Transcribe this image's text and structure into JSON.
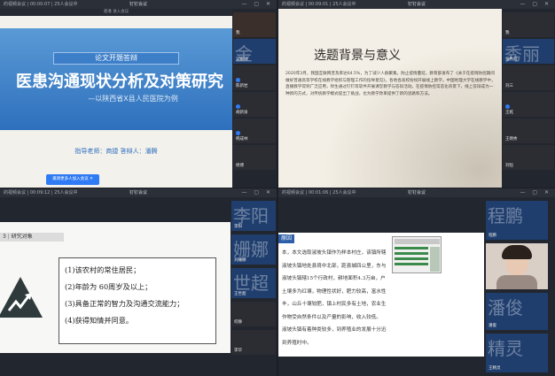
{
  "windows": {
    "tl": {
      "title": "钉钉会议",
      "meta": "的视频会议  |  00:00:07  |  25人会议中",
      "tabbar": "骆潘 进入会议"
    },
    "tr": {
      "title": "钉钉会议",
      "meta": "的视频会议  |  00:09:01  |  25人会议中"
    },
    "bl": {
      "title": "钉钉会议",
      "meta": "的视频会议  |  00:09:12  |  25人会议中"
    },
    "br": {
      "title": "钉钉会议",
      "meta": "的视频会议  |  00:01:06  |  25人会议中"
    },
    "controls": "— ▢ ✕"
  },
  "slide_tl": {
    "badge": "论文开题答辩",
    "title": "医患沟通现状分析及对策研究",
    "subtitle": "—以陕西省X县人民医院为例",
    "advisor": "指导老师：商捷  答辩人：潘腾",
    "share_button": "邀请更多人加入会议 ✕"
  },
  "slide_tr": {
    "title": "选题背景与意义",
    "paragraph": "2020年3月，我国互联网普及率达64.5%，为了减少人群聚集，防止疫情蔓延，教育部发布了《关于在疫情防控期间做好普通高等学校在线教学组织与管理工作的指导意见》，各地各高校纷纷开展线上教学。中国地理大学在线教学中，直播教学得到广泛应用，师生通过钉钉等软件开展课堂教学与答辩活动。在疫情防控常态化背景下，线上答辩成为一种新的方式，对传统教学模式提出了挑战，也为教学改革提供了新的思路和方法。"
  },
  "slide_bl": {
    "heading_num": "3",
    "heading": "研究对象",
    "items": [
      "(1)该农村的常住居民；",
      "(2)年龄为  60周岁及以上；",
      "(3)具备正常的智力及沟通交流能力；",
      "(4)获得知情并同意。"
    ]
  },
  "slide_br": {
    "tag": "原因",
    "lines": [
      "本，本文选取淑坡头镇作为样本村庄，该镇所辖",
      "淑坡头镇地处县境中北部，距县城四公里，东与",
      "淑坡头镇辖15个行政村，耕地面积4.3万亩，户",
      "土壤多为红壤，物理性状好，肥力较高，富水性",
      "丰，山丘十壤较肥，镇上村民多有土地，农业生",
      "作物受自然条件以及产量的影响，收入较低。",
      "淑坡头镇有着种类较多，到养殖业的发展十分迅",
      "到养殖时中。"
    ]
  },
  "side_tl": [
    {
      "big": "",
      "name": "我",
      "style": "dark"
    },
    {
      "big": "金",
      "name": "吴家祥",
      "style": "blue"
    },
    {
      "big": "",
      "name": "陈新岩",
      "style": "dark"
    },
    {
      "big": "",
      "name": "胡新泉",
      "style": "dark"
    },
    {
      "big": "",
      "name": "韩成林",
      "style": "dark"
    },
    {
      "big": "",
      "name": "杨博",
      "style": "dark"
    }
  ],
  "side_tr": [
    {
      "big": "",
      "name": "我",
      "style": "dark"
    },
    {
      "big": "秀丽",
      "name": "张秀丽",
      "style": "blue"
    },
    {
      "big": "",
      "name": "刘三",
      "style": "dark"
    },
    {
      "big": "",
      "name": "王乾",
      "style": "dark"
    },
    {
      "big": "",
      "name": "王明秀",
      "style": "dark"
    },
    {
      "big": "",
      "name": "刘恒",
      "style": "dark"
    }
  ],
  "side_bl": [
    {
      "big": "李阳",
      "name": "李阳",
      "style": "blue"
    },
    {
      "big": "姗娜",
      "name": "刘姗娜",
      "style": "blue"
    },
    {
      "big": "世超",
      "name": "王世超",
      "style": "blue"
    },
    {
      "big": "",
      "name": "何静",
      "style": "dark"
    },
    {
      "big": "",
      "name": "李华",
      "style": "dark"
    }
  ],
  "side_br": [
    {
      "big": "程鹏",
      "name": "程鹏",
      "style": "blue"
    },
    {
      "big": "",
      "name": "马丽莎",
      "style": "dark"
    },
    {
      "big": "潘俊",
      "name": "潘俊",
      "style": "blue"
    },
    {
      "big": "精灵",
      "name": "王精灵",
      "style": "blue"
    },
    {
      "big": "",
      "name": "严晓东",
      "style": "dark"
    }
  ]
}
